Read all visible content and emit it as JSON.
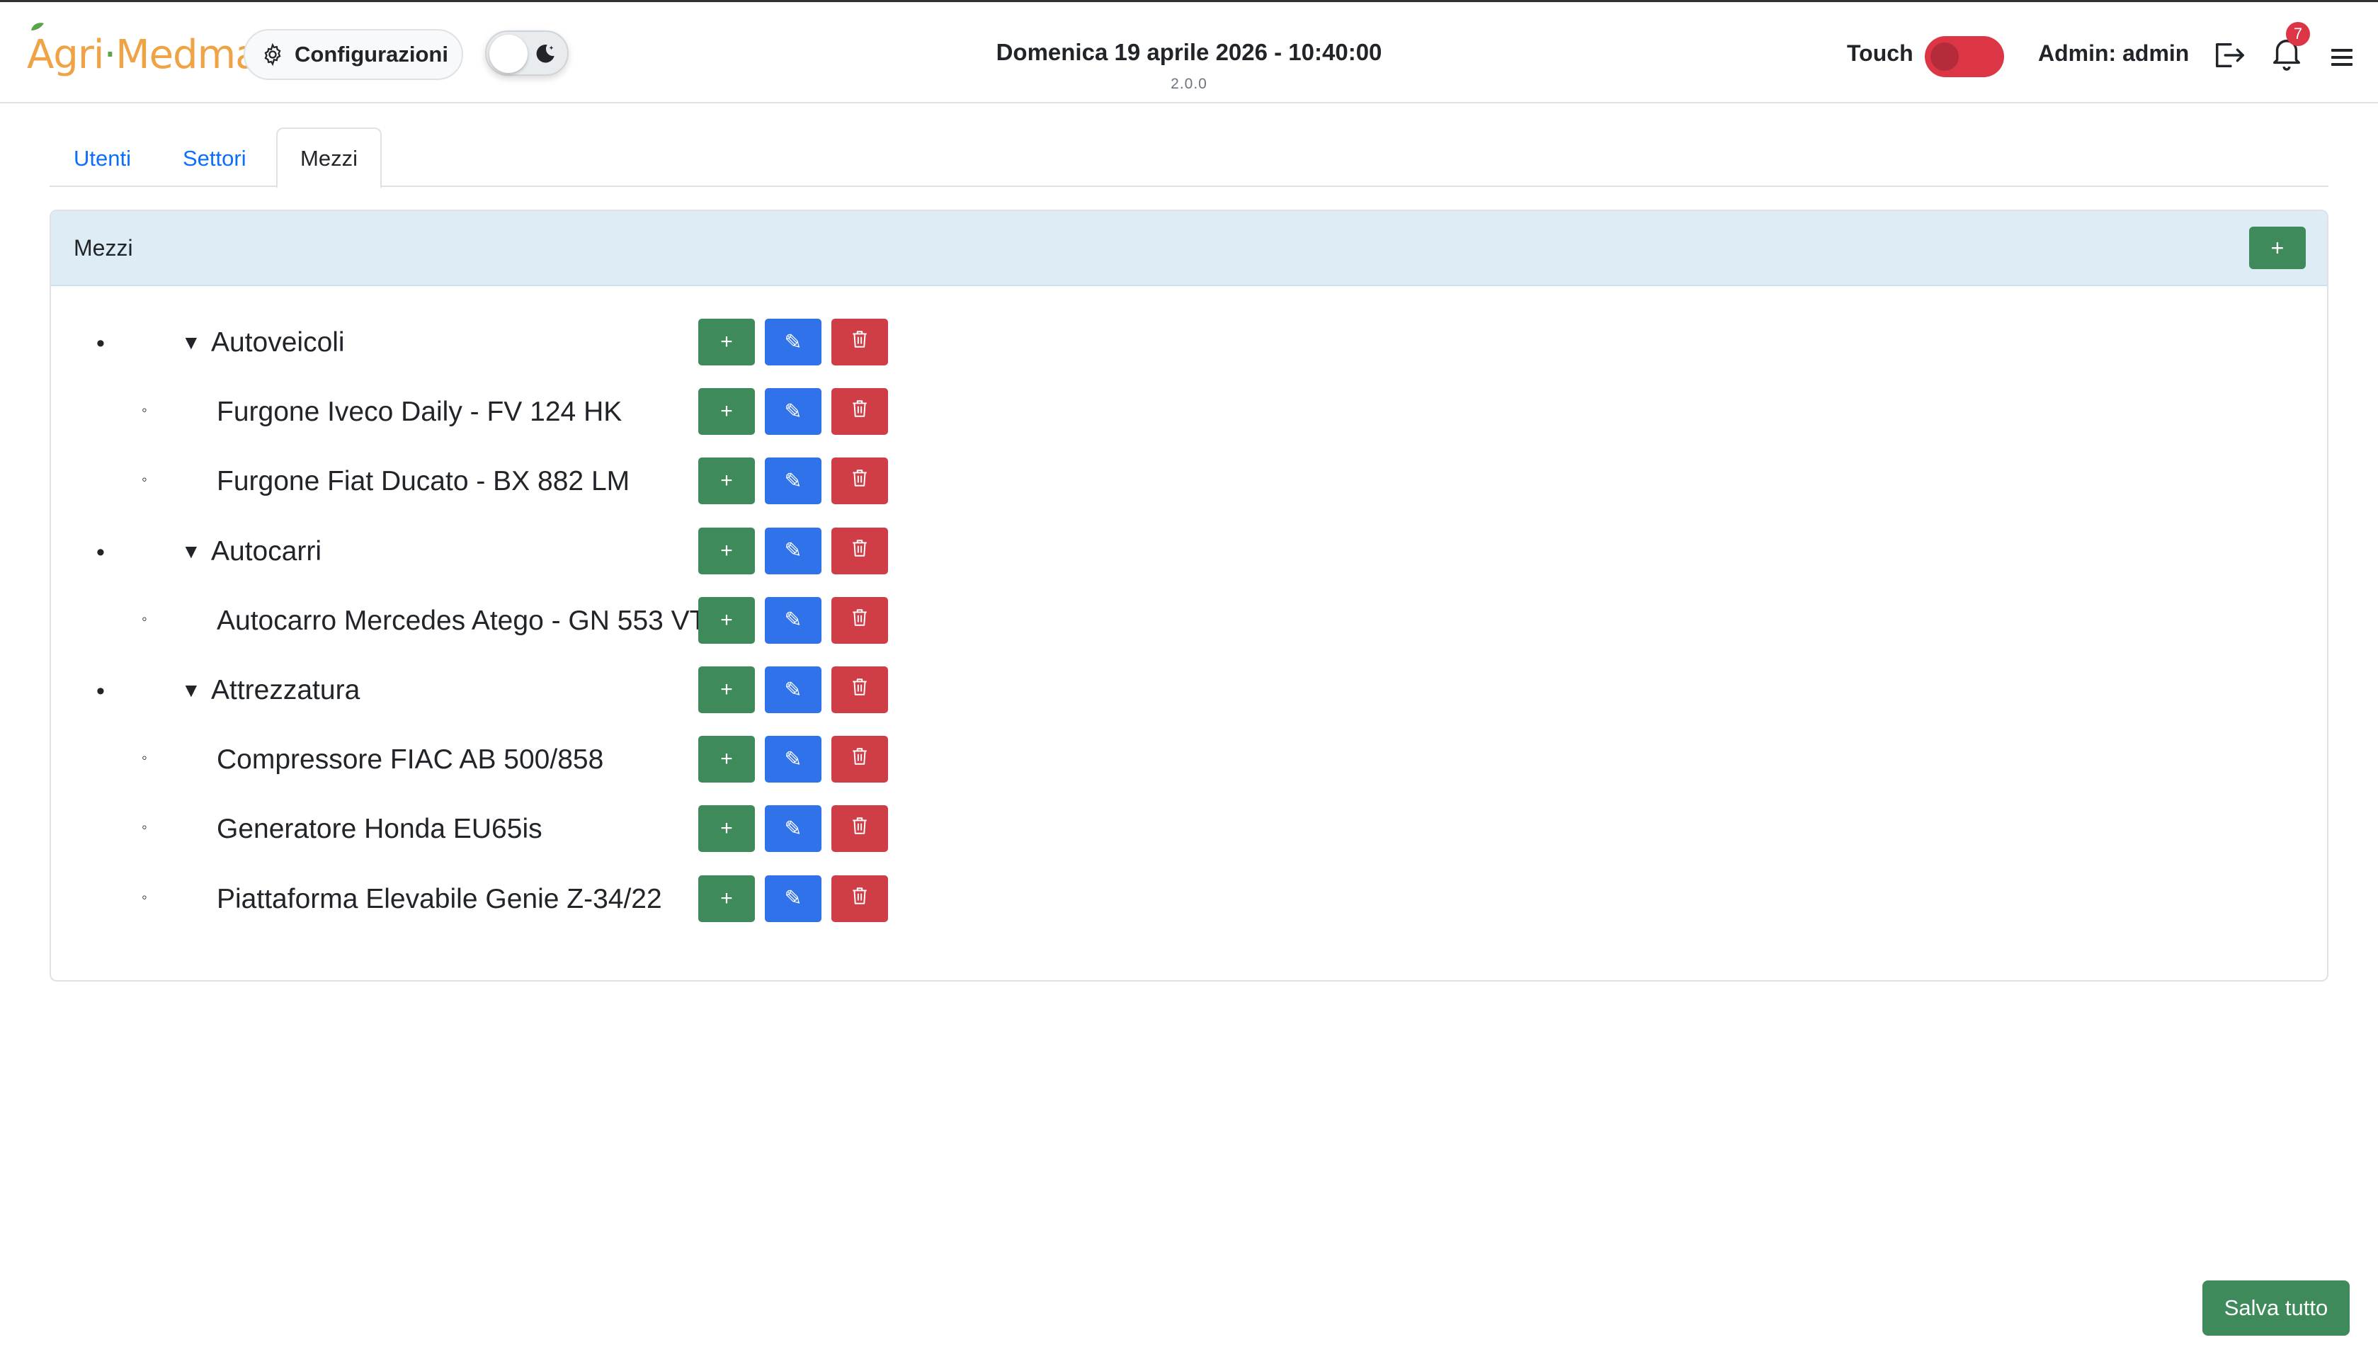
{
  "app": {
    "logo_text_a": "Agri",
    "logo_text_sep": "·",
    "logo_text_b": "Medma",
    "config_label": "Configurazioni",
    "datetime": "Domenica 19 aprile 2026 - 10:40:00",
    "version": "2.0.0",
    "touch_label": "Touch",
    "admin_label": "Admin: admin",
    "notification_count": "7",
    "dark_mode": false,
    "touch_enabled": false
  },
  "tabs": [
    {
      "label": "Utenti",
      "active": false
    },
    {
      "label": "Settori",
      "active": false
    },
    {
      "label": "Mezzi",
      "active": true
    }
  ],
  "card": {
    "title": "Mezzi",
    "add_label": "+"
  },
  "tree": [
    {
      "type": "category",
      "label": "Autoveicoli"
    },
    {
      "type": "item",
      "label": "Furgone Iveco Daily - FV 124 HK"
    },
    {
      "type": "item",
      "label": "Furgone Fiat Ducato - BX 882 LM"
    },
    {
      "type": "category",
      "label": "Autocarri"
    },
    {
      "type": "item",
      "label": "Autocarro Mercedes Atego - GN 553 VT"
    },
    {
      "type": "category",
      "label": "Attrezzatura"
    },
    {
      "type": "item",
      "label": "Compressore FIAC AB 500/858"
    },
    {
      "type": "item",
      "label": "Generatore Honda EU65is"
    },
    {
      "type": "item",
      "label": "Piattaforma Elevabile Genie Z-34/22"
    }
  ],
  "row_actions": {
    "add": "+",
    "edit": "✎"
  },
  "symbols": {
    "bullet_category": "•",
    "bullet_item": "◦",
    "caret": "▼"
  },
  "icons": [
    "gear-icon",
    "moon-icon",
    "logout-icon",
    "bell-icon",
    "menu-icon",
    "pencil-icon",
    "trash-icon"
  ],
  "footer": {
    "save_label": "Salva tutto"
  },
  "colors": {
    "success": "#3f8a5a",
    "primary": "#2f72ea",
    "danger": "#cf3e47",
    "header_bg": "#deecf5",
    "logo_orange": "#f0a345"
  }
}
